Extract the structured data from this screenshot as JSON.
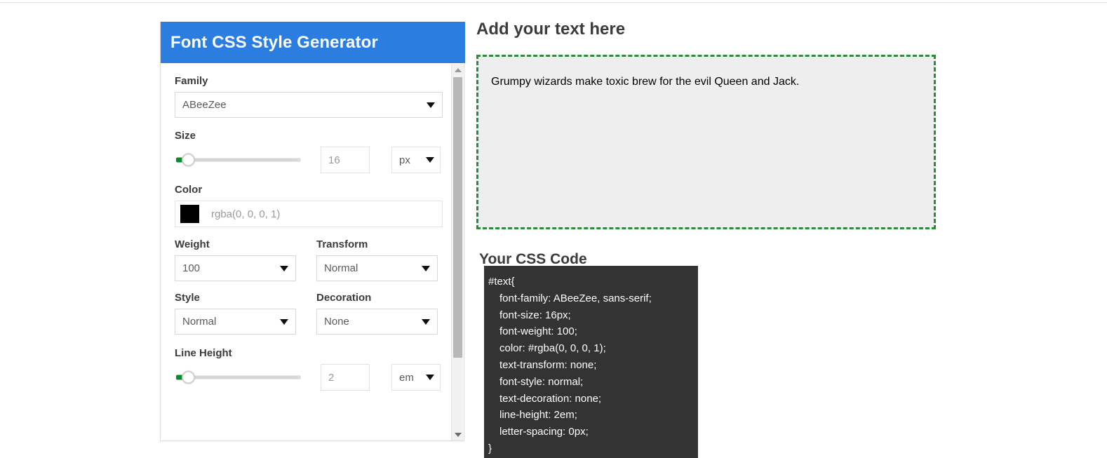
{
  "panel": {
    "title": "Font CSS Style Generator",
    "fields": {
      "family": {
        "label": "Family",
        "value": "ABeeZee"
      },
      "size": {
        "label": "Size",
        "value": "16",
        "unit": "px"
      },
      "color": {
        "label": "Color",
        "value": "rgba(0, 0, 0, 1)",
        "swatch_hex": "#000000"
      },
      "weight": {
        "label": "Weight",
        "value": "100"
      },
      "transform": {
        "label": "Transform",
        "value": "Normal"
      },
      "style": {
        "label": "Style",
        "value": "Normal"
      },
      "decoration": {
        "label": "Decoration",
        "value": "None"
      },
      "line_height": {
        "label": "Line Height",
        "value": "2",
        "unit": "em"
      }
    }
  },
  "preview": {
    "heading": "Add your text here",
    "text": "Grumpy wizards make toxic brew for the evil Queen and Jack."
  },
  "css_output": {
    "heading": "Your CSS Code",
    "lines": [
      "#text{",
      "font-family: ABeeZee, sans-serif;",
      "font-size: 16px;",
      "font-weight: 100;",
      "color: #rgba(0, 0, 0, 1);",
      "text-transform: none;",
      "font-style: normal;",
      "text-decoration: none;",
      "line-height: 2em;",
      "letter-spacing: 0px;",
      "}"
    ]
  },
  "colors": {
    "header_blue": "#2b7de0",
    "preview_border_green": "#2e8b3e",
    "code_bg": "#333333",
    "slider_fill_green": "#0a8a28"
  }
}
